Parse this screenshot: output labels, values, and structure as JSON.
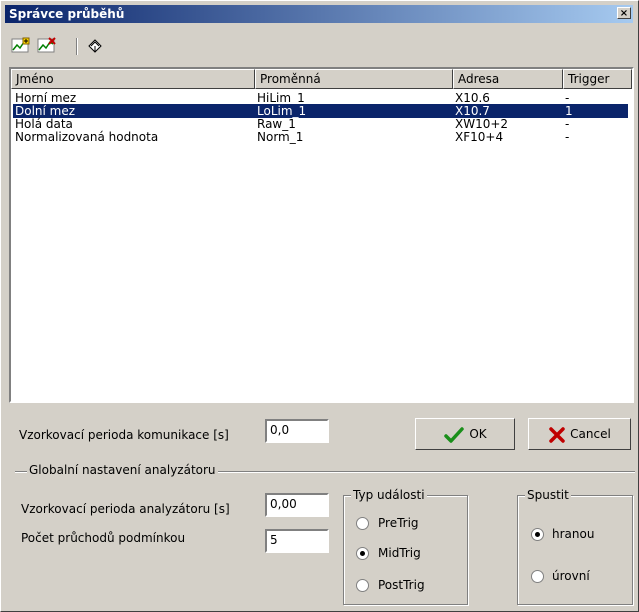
{
  "window": {
    "title": "Správce průběhů",
    "close_label": "×"
  },
  "toolbar": {
    "icons": [
      "add-chart-icon",
      "remove-chart-icon",
      "clear-icon"
    ]
  },
  "table": {
    "headers": [
      "Jméno",
      "Proměnná",
      "Adresa",
      "Trigger"
    ],
    "rows": [
      [
        "Horní mez",
        "HiLim_1",
        "X10.6",
        "-"
      ],
      [
        "Dolní mez",
        "LoLim_1",
        "X10.7",
        "1"
      ],
      [
        "Holá data",
        "Raw_1",
        "XW10+2",
        "-"
      ],
      [
        "Normalizovaná hodnota",
        "Norm_1",
        "XF10+4",
        "-"
      ]
    ],
    "selected_row": 1
  },
  "sampling": {
    "label": "Vzorkovací perioda komunikace [s]",
    "value": "0,0"
  },
  "buttons": {
    "ok": "OK",
    "cancel": "Cancel"
  },
  "global": {
    "title": "Globalní nastavení analyzátoru",
    "period_label": "Vzorkovací perioda analyzátoru [s]",
    "period_value": "0,00",
    "passes_label": "Počet průchodů podmínkou",
    "passes_value": "5"
  },
  "event_type": {
    "title": "Typ události",
    "options": [
      "PreTrig",
      "MidTrig",
      "PostTrig"
    ],
    "selected": "MidTrig"
  },
  "trigger_start": {
    "title": "Spustit",
    "options": [
      "hranou",
      "úrovní"
    ],
    "selected": "hranou"
  },
  "colors": {
    "selection": "#0a246a",
    "titlebar": "#0a246a",
    "face": "#d4d0c8",
    "ok_check": "#1a8f1a",
    "cancel_x": "#c00000"
  }
}
